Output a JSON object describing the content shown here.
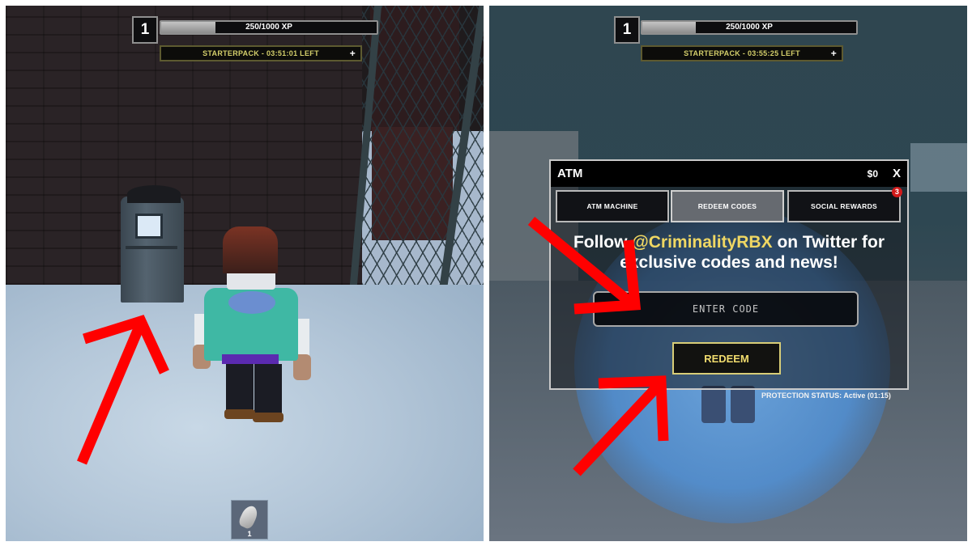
{
  "left_panel": {
    "hud": {
      "level": "1",
      "xp_text": "250/1000 XP",
      "xp_progress": 0.25,
      "starterpack_text": "STARTERPACK - 03:51:01 LEFT",
      "starterpack_plus": "+"
    },
    "hotbar": {
      "slot_count": "1",
      "item_icon": "fist-icon"
    }
  },
  "right_panel": {
    "hud": {
      "level": "1",
      "xp_text": "250/1000 XP",
      "xp_progress": 0.25,
      "starterpack_text": "STARTERPACK - 03:55:25 LEFT",
      "starterpack_plus": "+"
    },
    "atm": {
      "title": "ATM",
      "money": "$0",
      "close_label": "X",
      "tabs": [
        {
          "label": "ATM MACHINE",
          "active": false
        },
        {
          "label": "REDEEM CODES",
          "active": true
        },
        {
          "label": "SOCIAL REWARDS",
          "active": false,
          "badge": "3"
        }
      ],
      "message_prefix": "Follow ",
      "message_handle": "@CriminalityRBX",
      "message_suffix": " on Twitter for exclusive codes and news!",
      "code_input_value": "",
      "code_input_placeholder": "ENTER CODE",
      "redeem_label": "REDEEM"
    },
    "protection_status": "PROTECTION STATUS: Active (01:15)"
  },
  "colors": {
    "annotation_arrow": "#ff0000",
    "handle_highlight": "#efd763",
    "redeem_text": "#f1dc6e",
    "badge": "#d31a1a"
  }
}
